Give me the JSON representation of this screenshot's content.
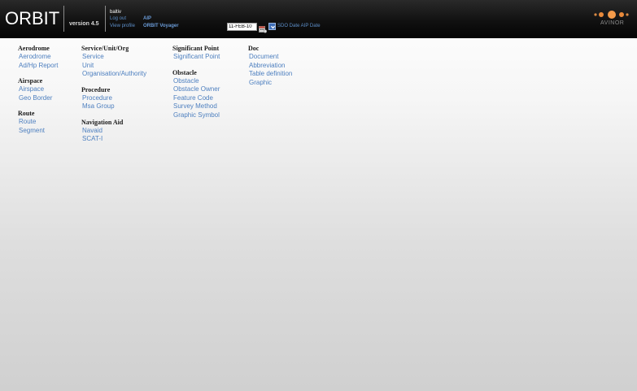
{
  "header": {
    "logo": "ORBIT",
    "version": "version 4.5",
    "username": "baltiv",
    "logout_label": "Log out",
    "aip_label": "AIP",
    "view_profile_label": "View profile",
    "voyager_label": "ORBIT Voyager",
    "date_value": "11-FEB-10",
    "sdo_label": "SDO Date AIP Date",
    "brand": "AVINOR",
    "brand_colors": [
      "#e38a3c",
      "#f59a45",
      "#e38a3c"
    ]
  },
  "menu": {
    "col1": [
      {
        "title": "Aerodrome",
        "items": [
          "Aerodrome",
          "Ad/Hp Report"
        ]
      },
      {
        "title": "Airspace",
        "items": [
          "Airspace",
          "Geo Border"
        ]
      },
      {
        "title": "Route",
        "items": [
          "Route",
          "Segment"
        ]
      }
    ],
    "col2": [
      {
        "title": "Service/Unit/Org",
        "items": [
          "Service",
          "Unit",
          "Organisation/Authority"
        ]
      },
      {
        "title": "Procedure",
        "items": [
          "Procedure",
          "Msa Group"
        ]
      },
      {
        "title": "Navigation Aid",
        "items": [
          "Navaid",
          "SCAT-I"
        ]
      }
    ],
    "col3": [
      {
        "title": "Significant Point",
        "items": [
          "Significant Point"
        ]
      },
      {
        "title": "Obstacle",
        "items": [
          "Obstacle",
          "Obstacle Owner",
          "Feature Code",
          "Survey Method",
          "Graphic Symbol"
        ]
      }
    ],
    "col4": [
      {
        "title": "Doc",
        "items": [
          "Document",
          "Abbreviation",
          "Table definition",
          "Graphic"
        ]
      }
    ]
  }
}
